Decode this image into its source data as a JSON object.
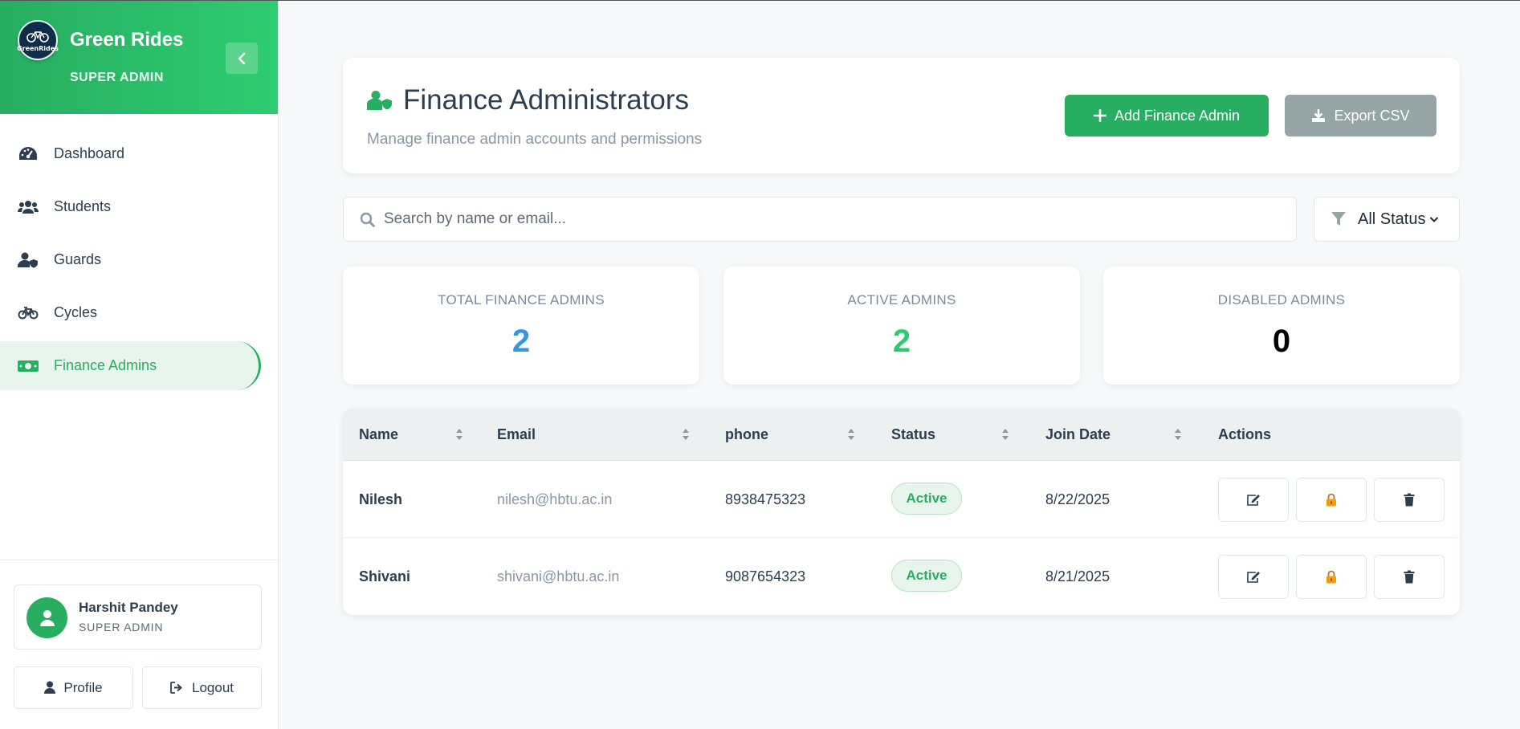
{
  "sidebar": {
    "logo_text": "GreenRides",
    "brand_name": "Green Rides",
    "brand_role": "SUPER ADMIN",
    "collapse_icon": "chevron-left-icon",
    "nav": [
      {
        "label": "Dashboard",
        "icon": "gauge-icon"
      },
      {
        "label": "Students",
        "icon": "users-icon"
      },
      {
        "label": "Guards",
        "icon": "user-shield-icon"
      },
      {
        "label": "Cycles",
        "icon": "bicycle-icon"
      },
      {
        "label": "Finance Admins",
        "icon": "money-bill-icon",
        "active": true
      }
    ],
    "user": {
      "name": "Harshit Pandey",
      "role": "SUPER ADMIN"
    },
    "profile_label": "Profile",
    "logout_label": "Logout"
  },
  "header": {
    "title": "Finance Administrators",
    "subtitle": "Manage finance admin accounts and permissions",
    "add_label": "Add Finance Admin",
    "export_label": "Export CSV"
  },
  "search": {
    "placeholder": "Search by name or email...",
    "value": ""
  },
  "filter": {
    "selected": "All Status"
  },
  "stats": [
    {
      "label": "TOTAL FINANCE ADMINS",
      "value": "2",
      "color": "#3498db"
    },
    {
      "label": "ACTIVE ADMINS",
      "value": "2",
      "color": "#2ecc71"
    },
    {
      "label": "DISABLED ADMINS",
      "value": "0",
      "color": "#000000"
    }
  ],
  "table": {
    "columns": [
      "Name",
      "Email",
      "phone",
      "Status",
      "Join Date",
      "Actions"
    ],
    "rows": [
      {
        "name": "Nilesh",
        "email": "nilesh@hbtu.ac.in",
        "phone": "8938475323",
        "status": "Active",
        "join_date": "8/22/2025"
      },
      {
        "name": "Shivani",
        "email": "shivani@hbtu.ac.in",
        "phone": "9087654323",
        "status": "Active",
        "join_date": "8/21/2025"
      }
    ]
  },
  "colors": {
    "accent": "#27ae60",
    "accent_light": "#2ecc71",
    "export": "#95a5a6",
    "lock": "#f39c12"
  }
}
